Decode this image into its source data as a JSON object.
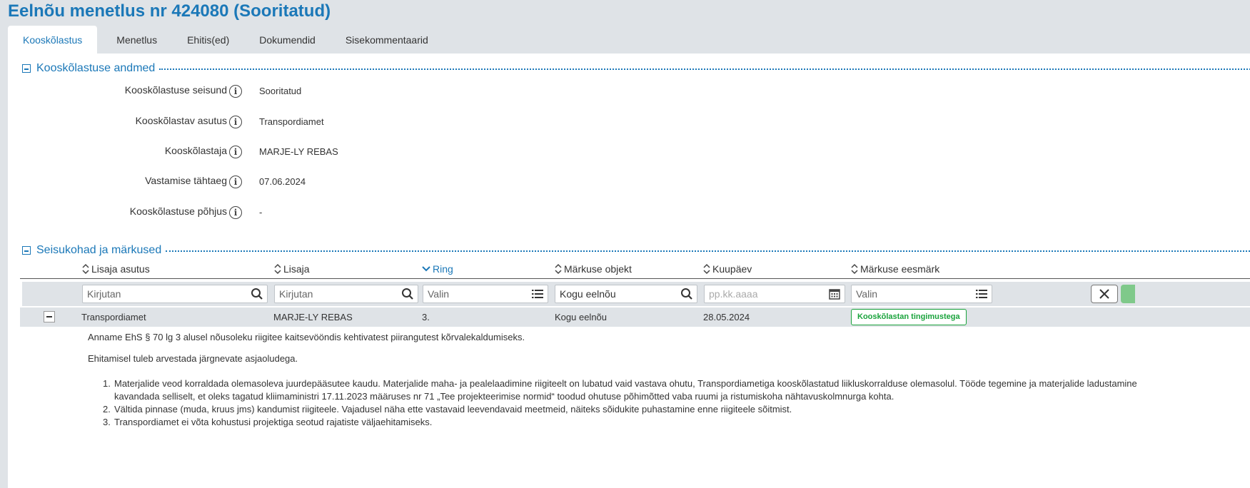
{
  "page": {
    "title": "Eelnõu menetlus nr 424080 (Sooritatud)"
  },
  "tabs": [
    {
      "label": "Kooskõlastus",
      "active": true
    },
    {
      "label": "Menetlus",
      "active": false
    },
    {
      "label": "Ehitis(ed)",
      "active": false
    },
    {
      "label": "Dokumendid",
      "active": false
    },
    {
      "label": "Sisekommentaarid",
      "active": false
    }
  ],
  "section1": {
    "title": "Kooskõlastuse andmed",
    "fields": [
      {
        "label": "Kooskõlastuse seisund",
        "value": "Sooritatud"
      },
      {
        "label": "Kooskõlastav asutus",
        "value": "Transpordiamet"
      },
      {
        "label": "Kooskõlastaja",
        "value": "MARJE-LY REBAS"
      },
      {
        "label": "Vastamise tähtaeg",
        "value": "07.06.2024"
      },
      {
        "label": "Kooskõlastuse põhjus",
        "value": "-"
      }
    ]
  },
  "section2": {
    "title": "Seisukohad ja märkused",
    "columns": [
      {
        "label": "Lisaja asutus",
        "sorted": false
      },
      {
        "label": "Lisaja",
        "sorted": false
      },
      {
        "label": "Ring",
        "sorted": true
      },
      {
        "label": "Märkuse objekt",
        "sorted": false
      },
      {
        "label": "Kuupäev",
        "sorted": false
      },
      {
        "label": "Märkuse eesmärk",
        "sorted": false
      }
    ],
    "filters": [
      {
        "placeholder": "Kirjutan",
        "icon": "search-icon"
      },
      {
        "placeholder": "Kirjutan",
        "icon": "search-icon"
      },
      {
        "placeholder": "Valin",
        "icon": "list-icon"
      },
      {
        "value": "Kogu eelnõu",
        "icon": "search-icon"
      },
      {
        "placeholder": "pp.kk.aaaa",
        "icon": "calendar-icon"
      },
      {
        "placeholder": "Valin",
        "icon": "list-icon"
      }
    ],
    "row": {
      "asutus": "Transpordiamet",
      "lisaja": "MARJE-LY REBAS",
      "ring": "3.",
      "objekt": "Kogu eelnõu",
      "kuupaev": "28.05.2024",
      "eesmark": "Kooskõlastan tingimustega"
    },
    "detail": {
      "p1": "Anname EhS § 70 lg 3 alusel nõusoleku riigitee kaitsevööndis kehtivatest piirangutest kõrvalekaldumiseks.",
      "p2": "Ehitamisel tuleb arvestada järgnevate asjaoludega.",
      "items": [
        {
          "num": "1.",
          "line1": "Materjalide veod korraldada olemasoleva juurdepääsutee kaudu. Materjalide maha- ja pealelaadimine riigiteelt on lubatud vaid vastava ohutu, Transpordiametiga kooskõlastatud liikluskorralduse olemasolul. Tööde tegemine ja materjalide ladustamine",
          "line2": "kavandada selliselt, et oleks tagatud kliimaministri 17.11.2023 määruses nr 71 „Tee projekteerimise normid“ toodud ohutuse põhimõtted vaba ruumi ja ristumiskoha nähtavuskolmnurga kohta."
        },
        {
          "num": "2.",
          "line1": "Vältida pinnase (muda, kruus jms) kandumist riigiteele. Vajadusel näha ette vastavaid leevendavaid meetmeid, näiteks sõidukite puhastamine enne riigiteele sõitmist.",
          "line2": ""
        },
        {
          "num": "3.",
          "line1": "Transpordiamet ei võta kohustusi projektiga seotud rajatiste väljaehitamiseks.",
          "line2": ""
        }
      ]
    }
  },
  "colors": {
    "accent": "#1b78b8",
    "success": "#1aa33c",
    "background": "#dfe3e7"
  }
}
